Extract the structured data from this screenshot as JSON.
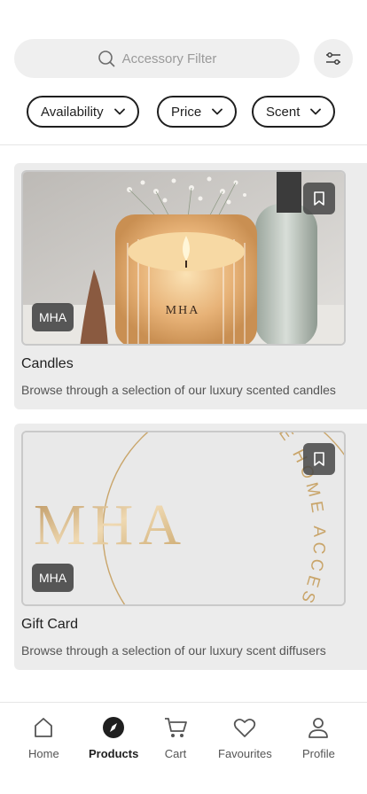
{
  "search": {
    "placeholder": "Accessory Filter",
    "icon": "search-icon"
  },
  "filter_button": {
    "icon": "sliders-icon"
  },
  "filters": [
    {
      "label": "Availability"
    },
    {
      "label": "Price"
    },
    {
      "label": "Scent"
    }
  ],
  "products": [
    {
      "title": "Candles",
      "description": "Browse through a selection of our luxury scented candles",
      "badge": "MHA",
      "image_text": "MHA"
    },
    {
      "title": "Gift Card",
      "description": "Browse through a selection of our luxury scent diffusers",
      "badge": "MHA",
      "image_text": "MHA",
      "ring_text": "E HOME ACCESSORI"
    }
  ],
  "nav": {
    "items": [
      {
        "label": "Home",
        "icon": "home-icon"
      },
      {
        "label": "Products",
        "icon": "compass-icon"
      },
      {
        "label": "Cart",
        "icon": "cart-icon"
      },
      {
        "label": "Favourites",
        "icon": "heart-icon"
      },
      {
        "label": "Profile",
        "icon": "user-icon"
      }
    ],
    "active": "Products"
  },
  "colors": {
    "accent": "#1f1f1f",
    "gold": "#c9a56a",
    "card_bg": "#ececec"
  }
}
